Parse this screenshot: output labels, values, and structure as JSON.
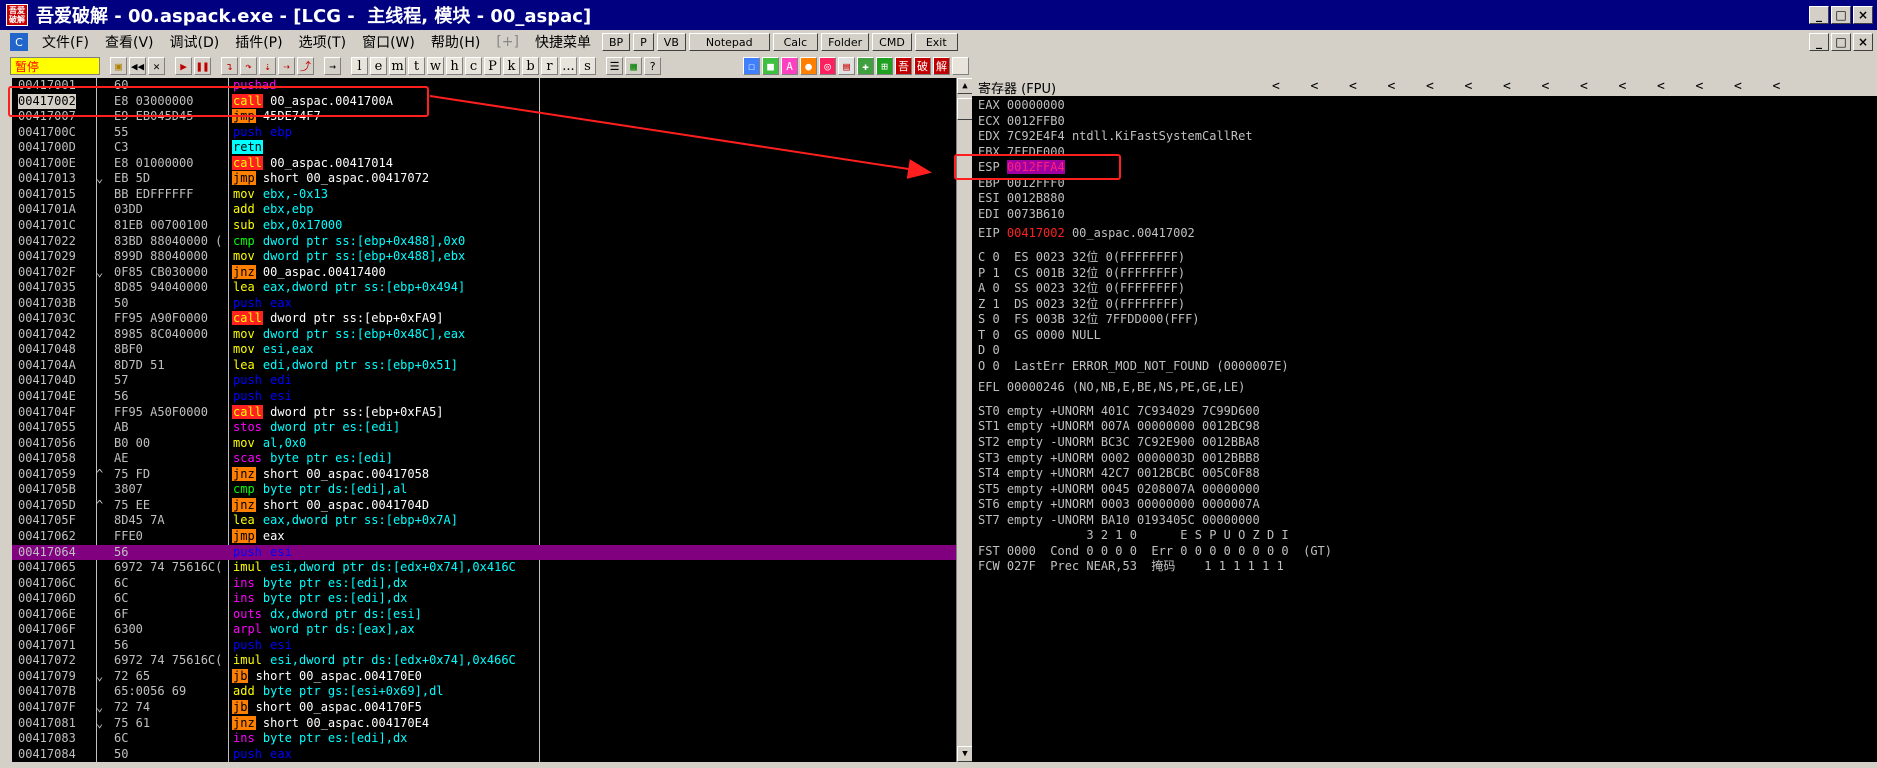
{
  "window": {
    "app_icon_text": "吾爱\n破解",
    "title": "吾爱破解 - 00.aspack.exe - [LCG -  主线程, 模块 - 00_aspac]",
    "buttons": [
      "_",
      "□",
      "×"
    ]
  },
  "menu": {
    "items": [
      "文件(F)",
      "查看(V)",
      "调试(D)",
      "插件(P)",
      "选项(T)",
      "窗口(W)",
      "帮助(H)",
      "[+]",
      "快捷菜单"
    ],
    "quick_buttons": [
      "BP",
      "P",
      "VB",
      "Notepad",
      "Calc",
      "Folder",
      "CMD",
      "Exit"
    ],
    "mdi_buttons": [
      "_",
      "□",
      "×"
    ]
  },
  "toolbar": {
    "state_label": "暂停",
    "letter_buttons": [
      "l",
      "e",
      "m",
      "t",
      "w",
      "h",
      "c",
      "P",
      "k",
      "b",
      "r",
      "...",
      "s"
    ],
    "icons": [
      "open-icon",
      "rewind-icon",
      "close-icon",
      "run-icon",
      "pause-icon",
      "step-into-icon",
      "step-over-icon",
      "trace-into-icon",
      "trace-over-icon",
      "execute-till-return-icon",
      "goto-icon"
    ],
    "right_icons": [
      "list-icon",
      "grid-icon",
      "help-icon"
    ],
    "color_icons": [
      "tool-icon-1",
      "tool-icon-2",
      "tool-icon-3",
      "tool-icon-4",
      "tool-icon-5",
      "tool-icon-6",
      "tool-icon-7",
      "tool-icon-8",
      "tool-icon-9",
      "tool-icon-10",
      "tool-icon-11"
    ]
  },
  "colors": {
    "mnem_call_bg": "#ff2020",
    "mnem_call_fg": "#ffff00",
    "mnem_jmp_bg": "#ff8000",
    "push_fg": "#0000ff",
    "retn_bg": "#00ffff",
    "mov_fg": "#ffff00",
    "cmp_fg": "#00ff00",
    "string_fg": "#ff00ff",
    "highlight_row": "#800080",
    "annotation": "#ff1f1f"
  },
  "disasm": {
    "rows": [
      {
        "addr": "00417001",
        "arrow": "",
        "hex": "60",
        "mn": "pushad",
        "op": "",
        "cls": "m-plain"
      },
      {
        "addr": "00417002",
        "arrow": "",
        "hex": "E8 03000000",
        "mn": "call",
        "op": " 00_aspac.0041700A",
        "cls": "m-call",
        "sel": true
      },
      {
        "addr": "00417007",
        "arrow": "",
        "hex": "E9 EB045D45",
        "mn": "jmp",
        "op": " 45DE74F7",
        "cls": "m-jmp"
      },
      {
        "addr": "0041700C",
        "arrow": "",
        "hex": "55",
        "mn": "push",
        "op": " ebp",
        "cls": "m-push"
      },
      {
        "addr": "0041700D",
        "arrow": "",
        "hex": "C3",
        "mn": "retn",
        "op": "",
        "cls": "m-retn"
      },
      {
        "addr": "0041700E",
        "arrow": "",
        "hex": "E8 01000000",
        "mn": "call",
        "op": " 00_aspac.00417014",
        "cls": "m-call"
      },
      {
        "addr": "00417013",
        "arrow": "⌄",
        "hex": "EB 5D",
        "mn": "jmp",
        "op": " short 00_aspac.00417072",
        "cls": "m-jmp"
      },
      {
        "addr": "00417015",
        "arrow": "",
        "hex": "BB EDFFFFFF",
        "mn": "mov",
        "op": " ebx,-0x13",
        "cls": "m-mov"
      },
      {
        "addr": "0041701A",
        "arrow": "",
        "hex": "03DD",
        "mn": "add",
        "op": " ebx,ebp",
        "cls": "m-mov"
      },
      {
        "addr": "0041701C",
        "arrow": "",
        "hex": "81EB 00700100",
        "mn": "sub",
        "op": " ebx,0x17000",
        "cls": "m-mov"
      },
      {
        "addr": "00417022",
        "arrow": "",
        "hex": "83BD 88040000 (",
        "mn": "cmp",
        "op": " dword ptr ss:[ebp+0x488],0x0",
        "cls": "m-cmp"
      },
      {
        "addr": "00417029",
        "arrow": "",
        "hex": "899D 88040000",
        "mn": "mov",
        "op": " dword ptr ss:[ebp+0x488],ebx",
        "cls": "m-mov"
      },
      {
        "addr": "0041702F",
        "arrow": "⌄",
        "hex": "0F85 CB030000",
        "mn": "jnz",
        "op": " 00_aspac.00417400",
        "cls": "m-jmp"
      },
      {
        "addr": "00417035",
        "arrow": "",
        "hex": "8D85 94040000",
        "mn": "lea",
        "op": " eax,dword ptr ss:[ebp+0x494]",
        "cls": "m-mov"
      },
      {
        "addr": "0041703B",
        "arrow": "",
        "hex": "50",
        "mn": "push",
        "op": " eax",
        "cls": "m-push"
      },
      {
        "addr": "0041703C",
        "arrow": "",
        "hex": "FF95 A90F0000",
        "mn": "call",
        "op": " dword ptr ss:[ebp+0xFA9]",
        "cls": "m-call"
      },
      {
        "addr": "00417042",
        "arrow": "",
        "hex": "8985 8C040000",
        "mn": "mov",
        "op": " dword ptr ss:[ebp+0x48C],eax",
        "cls": "m-mov"
      },
      {
        "addr": "00417048",
        "arrow": "",
        "hex": "8BF0",
        "mn": "mov",
        "op": " esi,eax",
        "cls": "m-mov"
      },
      {
        "addr": "0041704A",
        "arrow": "",
        "hex": "8D7D 51",
        "mn": "lea",
        "op": " edi,dword ptr ss:[ebp+0x51]",
        "cls": "m-mov"
      },
      {
        "addr": "0041704D",
        "arrow": "",
        "hex": "57",
        "mn": "push",
        "op": " edi",
        "cls": "m-push"
      },
      {
        "addr": "0041704E",
        "arrow": "",
        "hex": "56",
        "mn": "push",
        "op": " esi",
        "cls": "m-push"
      },
      {
        "addr": "0041704F",
        "arrow": "",
        "hex": "FF95 A50F0000",
        "mn": "call",
        "op": " dword ptr ss:[ebp+0xFA5]",
        "cls": "m-call"
      },
      {
        "addr": "00417055",
        "arrow": "",
        "hex": "AB",
        "mn": "stos",
        "op": " dword ptr es:[edi]",
        "cls": "m-str"
      },
      {
        "addr": "00417056",
        "arrow": "",
        "hex": "B0 00",
        "mn": "mov",
        "op": " al,0x0",
        "cls": "m-mov"
      },
      {
        "addr": "00417058",
        "arrow": "",
        "hex": "AE",
        "mn": "scas",
        "op": " byte ptr es:[edi]",
        "cls": "m-str"
      },
      {
        "addr": "00417059",
        "arrow": "^",
        "hex": "75 FD",
        "mn": "jnz",
        "op": " short 00_aspac.00417058",
        "cls": "m-jmp"
      },
      {
        "addr": "0041705B",
        "arrow": "",
        "hex": "3807",
        "mn": "cmp",
        "op": " byte ptr ds:[edi],al",
        "cls": "m-cmp"
      },
      {
        "addr": "0041705D",
        "arrow": "^",
        "hex": "75 EE",
        "mn": "jnz",
        "op": " short 00_aspac.0041704D",
        "cls": "m-jmp"
      },
      {
        "addr": "0041705F",
        "arrow": "",
        "hex": "8D45 7A",
        "mn": "lea",
        "op": " eax,dword ptr ss:[ebp+0x7A]",
        "cls": "m-mov"
      },
      {
        "addr": "00417062",
        "arrow": "",
        "hex": "FFE0",
        "mn": "jmp",
        "op": " eax",
        "cls": "m-jmp"
      },
      {
        "addr": "00417064",
        "arrow": "",
        "hex": "56",
        "mn": "push",
        "op": " esi",
        "cls": "m-push",
        "hl": true
      },
      {
        "addr": "00417065",
        "arrow": "",
        "hex": "6972 74 75616C(",
        "mn": "imul",
        "op": " esi,dword ptr ds:[edx+0x74],0x416C",
        "cls": "m-mov"
      },
      {
        "addr": "0041706C",
        "arrow": "",
        "hex": "6C",
        "mn": "ins",
        "op": " byte ptr es:[edi],dx",
        "cls": "m-str"
      },
      {
        "addr": "0041706D",
        "arrow": "",
        "hex": "6C",
        "mn": "ins",
        "op": " byte ptr es:[edi],dx",
        "cls": "m-str"
      },
      {
        "addr": "0041706E",
        "arrow": "",
        "hex": "6F",
        "mn": "outs",
        "op": " dx,dword ptr ds:[esi]",
        "cls": "m-str"
      },
      {
        "addr": "0041706F",
        "arrow": "",
        "hex": "6300",
        "mn": "arpl",
        "op": " word ptr ds:[eax],ax",
        "cls": "m-str"
      },
      {
        "addr": "00417071",
        "arrow": "",
        "hex": "56",
        "mn": "push",
        "op": " esi",
        "cls": "m-push"
      },
      {
        "addr": "00417072",
        "arrow": "",
        "hex": "6972 74 75616C(",
        "mn": "imul",
        "op": " esi,dword ptr ds:[edx+0x74],0x466C",
        "cls": "m-mov"
      },
      {
        "addr": "00417079",
        "arrow": "⌄",
        "hex": "72 65",
        "mn": "jb",
        "op": " short 00_aspac.004170E0",
        "cls": "m-jmp"
      },
      {
        "addr": "0041707B",
        "arrow": "",
        "hex": "65:0056 69",
        "mn": "add",
        "op": " byte ptr gs:[esi+0x69],dl",
        "cls": "m-mov"
      },
      {
        "addr": "0041707F",
        "arrow": "⌄",
        "hex": "72 74",
        "mn": "jb",
        "op": " short 00_aspac.004170F5",
        "cls": "m-jmp"
      },
      {
        "addr": "00417081",
        "arrow": "⌄",
        "hex": "75 61",
        "mn": "jnz",
        "op": " short 00_aspac.004170E4",
        "cls": "m-jmp"
      },
      {
        "addr": "00417083",
        "arrow": "",
        "hex": "6C",
        "mn": "ins",
        "op": " byte ptr es:[edi],dx",
        "cls": "m-str"
      },
      {
        "addr": "00417084",
        "arrow": "",
        "hex": "50",
        "mn": "push",
        "op": " eax",
        "cls": "m-push"
      }
    ]
  },
  "registers": {
    "header": "寄存器 (FPU)",
    "header_arrows": [
      "<",
      "<",
      "<",
      "<",
      "<",
      "<",
      "<",
      "<",
      "<",
      "<",
      "<",
      "<",
      "<",
      "<"
    ],
    "general": [
      {
        "name": "EAX",
        "value": "00000000",
        "comment": ""
      },
      {
        "name": "ECX",
        "value": "0012FFB0",
        "comment": ""
      },
      {
        "name": "EDX",
        "value": "7C92E4F4",
        "comment": "ntdll.KiFastSystemCallRet"
      },
      {
        "name": "EBX",
        "value": "7FFDE000",
        "comment": ""
      },
      {
        "name": "ESP",
        "value": "0012FFA4",
        "comment": "",
        "esp": true
      },
      {
        "name": "EBP",
        "value": "0012FFF0",
        "comment": ""
      },
      {
        "name": "ESI",
        "value": "0012B880",
        "comment": ""
      },
      {
        "name": "EDI",
        "value": "0073B610",
        "comment": ""
      }
    ],
    "eip": {
      "name": "EIP",
      "value": "00417002",
      "comment": "00_aspac.00417002"
    },
    "flags": [
      "C 0  ES 0023 32位 0(FFFFFFFF)",
      "P 1  CS 001B 32位 0(FFFFFFFF)",
      "A 0  SS 0023 32位 0(FFFFFFFF)",
      "Z 1  DS 0023 32位 0(FFFFFFFF)",
      "S 0  FS 003B 32位 7FFDD000(FFF)",
      "T 0  GS 0000 NULL",
      "D 0",
      "O 0  LastErr ERROR_MOD_NOT_FOUND (0000007E)"
    ],
    "efl": "EFL 00000246 (NO,NB,E,BE,NS,PE,GE,LE)",
    "fpu": [
      "ST0 empty +UNORM 401C 7C934029 7C99D600",
      "ST1 empty +UNORM 007A 00000000 0012BC98",
      "ST2 empty -UNORM BC3C 7C92E900 0012BBA8",
      "ST3 empty +UNORM 0002 0000003D 0012BBB8",
      "ST4 empty +UNORM 42C7 0012BCBC 005C0F88",
      "ST5 empty +UNORM 0045 0208007A 00000000",
      "ST6 empty +UNORM 0003 00000000 0000007A",
      "ST7 empty -UNORM BA10 0193405C 00000000"
    ],
    "fpu_header": "               3 2 1 0      E S P U O Z D I",
    "fst": "FST 0000  Cond 0 0 0 0  Err 0 0 0 0 0 0 0 0  (GT)",
    "fcw": "FCW 027F  Prec NEAR,53  掩码    1 1 1 1 1 1"
  }
}
